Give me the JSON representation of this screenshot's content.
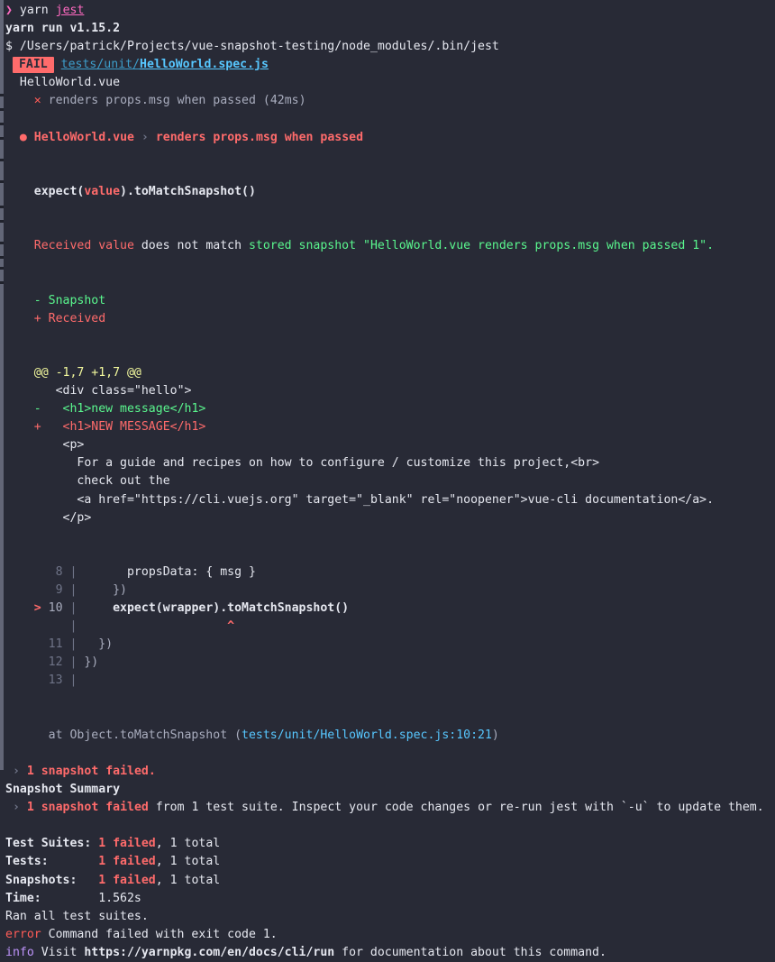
{
  "terminal": {
    "title": "jest test run output",
    "background_color": "#282a36",
    "foreground_color": "#e6e8f0",
    "accent_fail_color": "#ff6b6b",
    "accent_pass_color": "#5af78e",
    "accent_link_color": "#57c7ff"
  },
  "command": {
    "prompt": "❯",
    "program": "yarn",
    "argument": "jest"
  },
  "yarn": {
    "version_line": "yarn run v1.15.2",
    "dollar": "$",
    "binary_path": "/Users/patrick/Projects/vue-snapshot-testing/node_modules/.bin/jest"
  },
  "fail_header": {
    "badge": "FAIL",
    "path_dir": "tests/unit/",
    "path_file": "HelloWorld.spec.js"
  },
  "suite": {
    "name": "HelloWorld.vue",
    "test_marker": "✕",
    "test_name": "renders props.msg when passed",
    "test_duration": "(42ms)"
  },
  "failure": {
    "bullet": "●",
    "suite": "HelloWorld.vue",
    "separator": "›",
    "test": "renders props.msg when passed",
    "matcher_prefix": "expect(",
    "matcher_received": "value",
    "matcher_suffix": ").toMatchSnapshot()",
    "message_received": "Received value",
    "message_mid": " does not match ",
    "message_stored": "stored snapshot",
    "message_snapshot_name": " \"HelloWorld.vue renders props.msg when passed 1\".",
    "legend_snapshot": "- Snapshot",
    "legend_received": "+ Received"
  },
  "diff": {
    "hunk_header": "@@ -1,7 +1,7 @@",
    "lines": [
      {
        "sign": " ",
        "kind": "context",
        "text": "  <div class=\"hello\">"
      },
      {
        "sign": "-",
        "kind": "removed",
        "text": "   <h1>new message</h1>"
      },
      {
        "sign": "+",
        "kind": "added",
        "text": "   <h1>NEW MESSAGE</h1>"
      },
      {
        "sign": " ",
        "kind": "context",
        "text": "   <p>"
      },
      {
        "sign": " ",
        "kind": "context",
        "text": "     For a guide and recipes on how to configure / customize this project,<br>"
      },
      {
        "sign": " ",
        "kind": "context",
        "text": "     check out the"
      },
      {
        "sign": " ",
        "kind": "context",
        "text": "     <a href=\"https://cli.vuejs.org\" target=\"_blank\" rel=\"noopener\">vue-cli documentation</a>."
      },
      {
        "sign": " ",
        "kind": "context",
        "text": "   </p>"
      }
    ]
  },
  "codeframe": {
    "rows": [
      {
        "marker": "",
        "number": "8",
        "bar": "|",
        "code": "      propsData: { msg }",
        "highlight": false
      },
      {
        "marker": "",
        "number": "9",
        "bar": "|",
        "code": "    })",
        "highlight": false
      },
      {
        "marker": ">",
        "number": "10",
        "bar": "|",
        "code": "    expect(wrapper).toMatchSnapshot()",
        "highlight": true
      },
      {
        "marker": "",
        "number": "",
        "bar": "|",
        "code": "                    ^",
        "highlight": false,
        "caret": true
      },
      {
        "marker": "",
        "number": "11",
        "bar": "|",
        "code": "  })",
        "highlight": false
      },
      {
        "marker": "",
        "number": "12",
        "bar": "|",
        "code": "})",
        "highlight": false
      },
      {
        "marker": "",
        "number": "13",
        "bar": "|",
        "code": "",
        "highlight": false
      }
    ]
  },
  "stack": {
    "at_text": "at Object.toMatchSnapshot ",
    "open_paren": "(",
    "location": "tests/unit/HelloWorld.spec.js:10:21",
    "close_paren": ")"
  },
  "snapshot_summary": {
    "arrow": "›",
    "failed_short": "1 snapshot failed.",
    "heading": "Snapshot Summary",
    "failed_long_red": "1 snapshot failed",
    "failed_long_rest": " from 1 test suite. Inspect your code changes or re-run jest with `-u` to update them."
  },
  "totals": [
    {
      "label": "Test Suites:",
      "pad": " ",
      "red": "1 failed",
      "rest": ", 1 total"
    },
    {
      "label": "Tests:",
      "pad": "       ",
      "red": "1 failed",
      "rest": ", 1 total"
    },
    {
      "label": "Snapshots:",
      "pad": "   ",
      "red": "1 failed",
      "rest": ", 1 total"
    },
    {
      "label": "Time:",
      "pad": "        ",
      "red": "",
      "rest": "1.562s"
    }
  ],
  "footer": {
    "ran_all": "Ran all test suites.",
    "error_tag": "error",
    "error_text": " Command failed with exit code 1.",
    "info_tag": "info",
    "info_prefix": " Visit ",
    "info_url": "https://yarnpkg.com/en/docs/cli/run",
    "info_suffix": " for documentation about this command."
  }
}
